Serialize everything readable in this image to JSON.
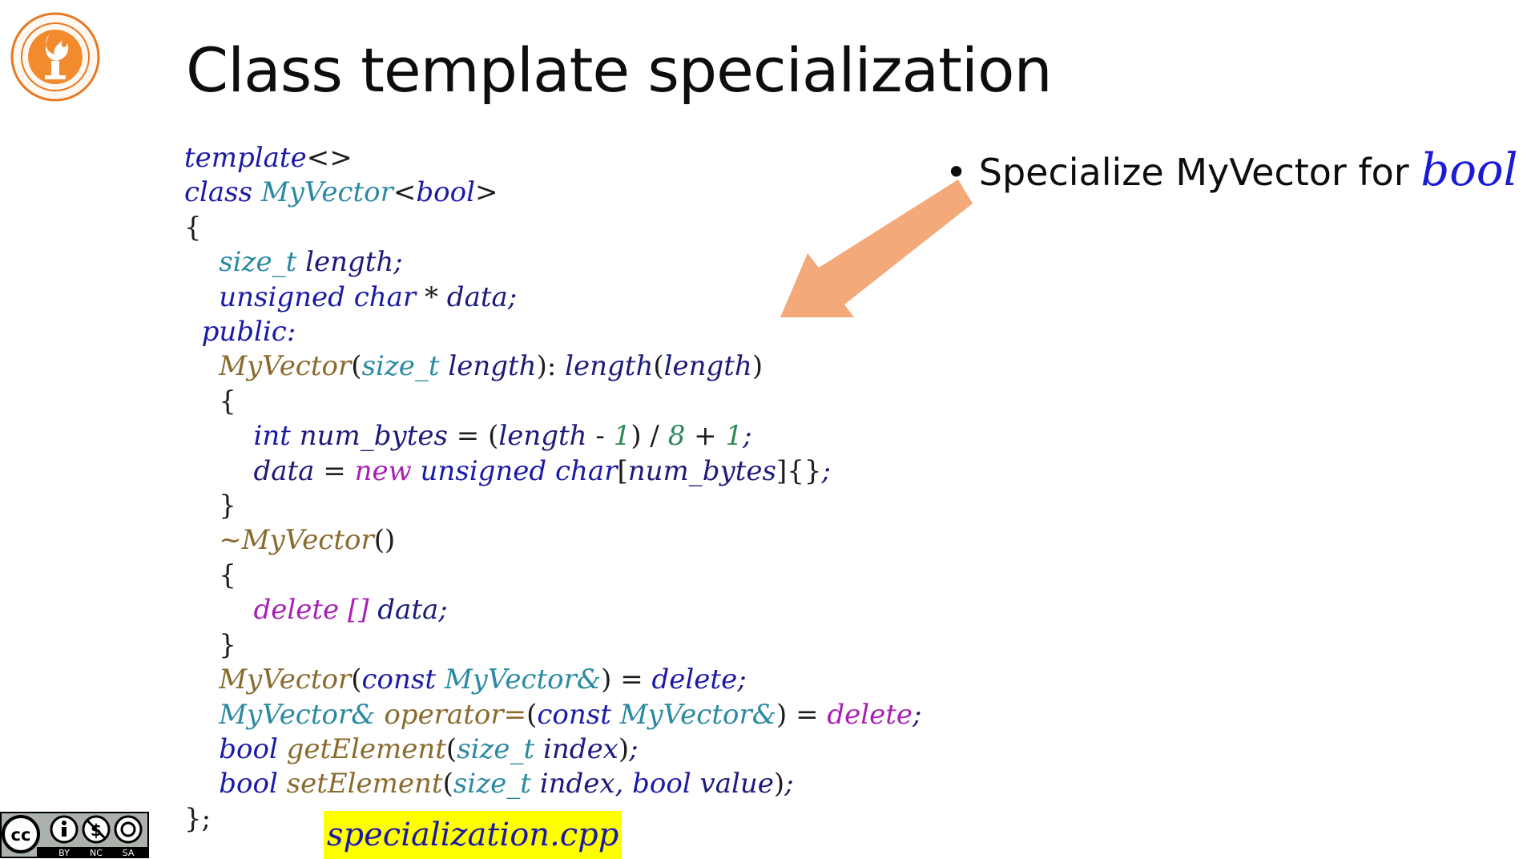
{
  "slide": {
    "title": "Class template specialization",
    "bullet": {
      "text": "Specialize MyVector for ",
      "emphasis": "bool"
    },
    "file_label": "specialization.cpp",
    "logo_icon": "university-seal-icon",
    "license": {
      "icon": "creative-commons-by-nc-sa-icon",
      "labels": [
        "BY",
        "NC",
        "SA"
      ]
    },
    "arrow_color": "#f4a97a",
    "highlight_color": "#ffff00",
    "colors": {
      "keyword": "#1a1aa6",
      "type": "#2b8aa3",
      "function": "#8a6b2e",
      "purple_keyword": "#a81fb5",
      "number": "#2e8b57"
    }
  },
  "code": {
    "lines": [
      "template<>",
      "class MyVector<bool>",
      "{",
      "    size_t length;",
      "    unsigned char * data;",
      "  public:",
      "    MyVector(size_t length): length(length)",
      "    {",
      "        int num_bytes = (length - 1) / 8 + 1;",
      "        data = new unsigned char[num_bytes]{};",
      "    }",
      "    ~MyVector()",
      "    {",
      "        delete [] data;",
      "    }",
      "    MyVector(const MyVector&) = delete;",
      "    MyVector& operator=(const MyVector&) = delete;",
      "    bool getElement(size_t index);",
      "    bool setElement(size_t index, bool value);",
      "};"
    ]
  }
}
